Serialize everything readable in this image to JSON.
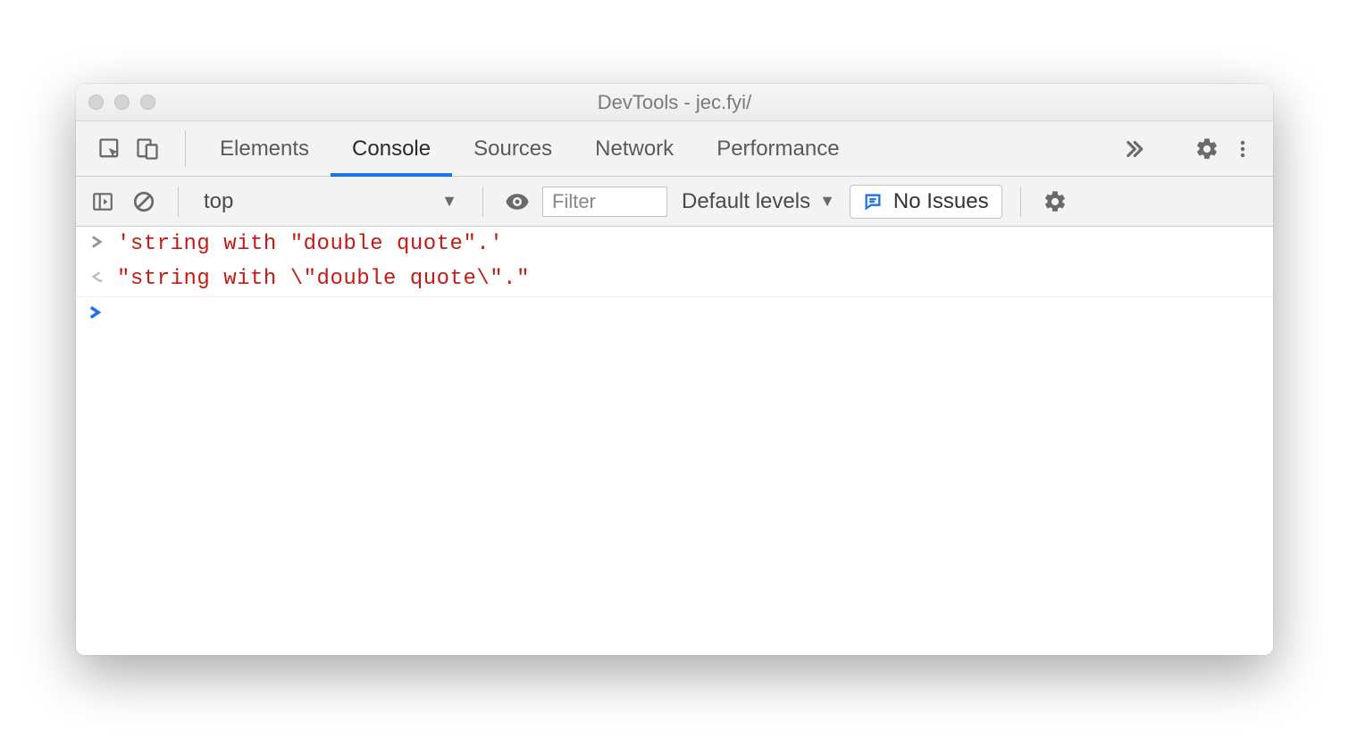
{
  "window": {
    "title": "DevTools - jec.fyi/"
  },
  "tabs": {
    "items": [
      "Elements",
      "Console",
      "Sources",
      "Network",
      "Performance"
    ],
    "active_index": 1
  },
  "console_toolbar": {
    "context": "top",
    "filter_placeholder": "Filter",
    "levels_label": "Default levels",
    "issues_label": "No Issues"
  },
  "console": {
    "rows": [
      {
        "type": "input",
        "text": "'string with \"double quote\".'"
      },
      {
        "type": "output",
        "text": "\"string with \\\"double quote\\\".\""
      }
    ]
  }
}
